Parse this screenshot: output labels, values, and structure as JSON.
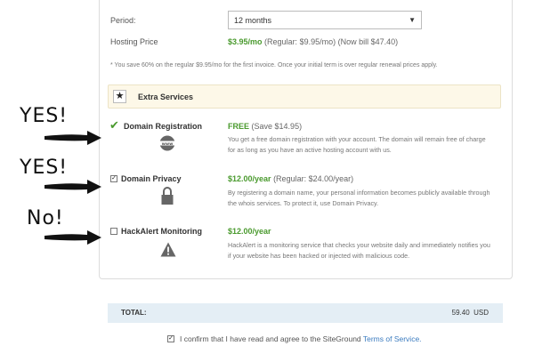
{
  "period": {
    "label": "Period:",
    "selected": "12 months"
  },
  "hosting_price": {
    "label": "Hosting Price",
    "price": "$3.95/mo",
    "details": "(Regular: $9.95/mo) (Now bill $47.40)"
  },
  "savings_note": "* You save 60% on the regular $9.95/mo for the first invoice. Once your initial term is over regular renewal prices apply.",
  "extra_services": {
    "title": "Extra Services",
    "items": [
      {
        "name": "Domain Registration",
        "price": "FREE",
        "price_note": "(Save $14.95)",
        "icon_label": "www",
        "description": "You get a free domain registration with your account. The domain will remain free of charge for as long as you have an active hosting account with us.",
        "checked": true
      },
      {
        "name": "Domain Privacy",
        "price": "$12.00/year",
        "price_note": "(Regular: $24.00/year)",
        "description": "By registering a domain name, your personal information becomes publicly available through the whois services. To protect it, use Domain Privacy.",
        "checked": true
      },
      {
        "name": "HackAlert Monitoring",
        "price": "$12.00/year",
        "price_note": "",
        "description": "HackAlert is a monitoring service that checks your website daily and immediately notifies you if your website has been hacked or injected with malicious code.",
        "checked": false
      }
    ]
  },
  "annotations": {
    "yes1": "YES!",
    "yes2": "YES!",
    "no": "No!"
  },
  "total": {
    "label": "TOTAL:",
    "value": "59.40  USD"
  },
  "confirm": {
    "text": "I confirm that I have read and agree to the SiteGround",
    "link": "Terms of Service."
  },
  "colors": {
    "accent_green": "#4a9a2e",
    "link_blue": "#3b7bbf",
    "total_bg": "#e4eef5",
    "extra_bg": "#fdf8e8"
  }
}
